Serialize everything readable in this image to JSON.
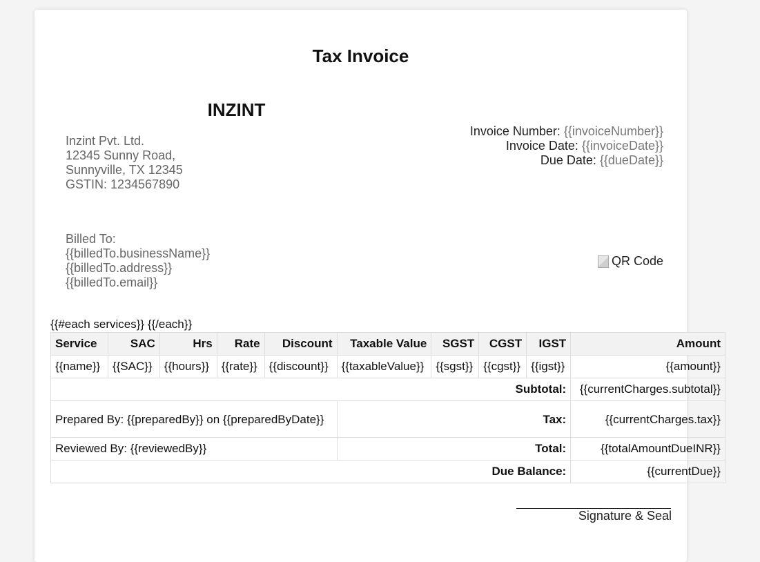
{
  "document": {
    "title": "Tax Invoice",
    "company": {
      "name": "INZINT",
      "legal_name": "Inzint Pvt. Ltd.",
      "address_line1": "12345 Sunny Road,",
      "address_line2": "Sunnyville, TX 12345",
      "gstin": "GSTIN: 1234567890"
    },
    "invoice_meta": {
      "number_label": "Invoice Number:",
      "number_value": "{{invoiceNumber}}",
      "date_label": "Invoice Date:",
      "date_value": "{{invoiceDate}}",
      "due_label": "Due Date:",
      "due_value": "{{dueDate}}"
    },
    "billed_to": {
      "label": "Billed To:",
      "business_name": "{{billedTo.businessName}}",
      "address": "{{billedTo.address}}",
      "email": "{{billedTo.email}}"
    },
    "qr_alt": "QR Code",
    "each_tag": "{{#each services}} {{/each}}",
    "table": {
      "headers": [
        "Service",
        "SAC",
        "Hrs",
        "Rate",
        "Discount",
        "Taxable Value",
        "SGST",
        "CGST",
        "IGST",
        "Amount"
      ],
      "row": [
        "{{name}}",
        "{{SAC}}",
        "{{hours}}",
        "{{rate}}",
        "{{discount}}",
        "{{taxableValue}}",
        "{{sgst}}",
        "{{cgst}}",
        "{{igst}}",
        "{{amount}}"
      ],
      "subtotal_label": "Subtotal:",
      "subtotal_value": "{{currentCharges.subtotal}}",
      "prepared_by": "Prepared By: {{preparedBy}} on {{preparedByDate}}",
      "tax_label": "Tax:",
      "tax_value": "{{currentCharges.tax}}",
      "reviewed_by": "Reviewed By: {{reviewedBy}}",
      "total_label": "Total:",
      "total_value": "{{totalAmountDueINR}}",
      "due_balance_label": "Due Balance:",
      "due_balance_value": "{{currentDue}}"
    },
    "signature_label": "Signature & Seal"
  }
}
